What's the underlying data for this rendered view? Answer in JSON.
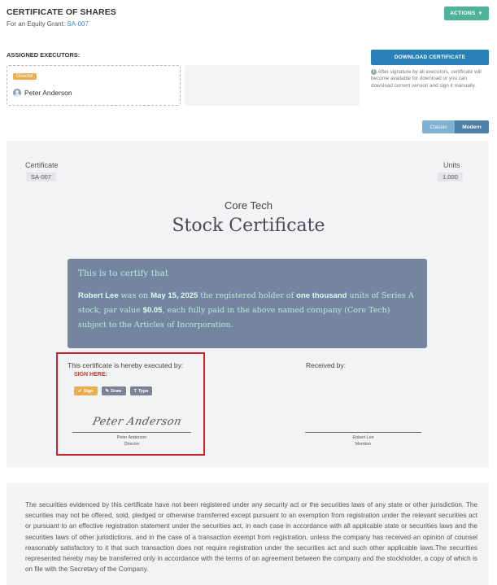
{
  "header": {
    "title": "CERTIFICATE OF SHARES",
    "subtitle_prefix": "For an Equity Grant:",
    "grant_link": "SA-007",
    "actions_label": "ACTIONS"
  },
  "executors": {
    "label": "ASSIGNED EXECUTORS:",
    "items": [
      {
        "role": "Director",
        "name": "Peter Anderson"
      }
    ]
  },
  "download": {
    "button_label": "DOWNLOAD CERTIFICATE",
    "note": "After signature by all executors, certificate will become available for download or you can download current version and sign it manually."
  },
  "view_toggle": {
    "options": [
      "Classic",
      "Modern"
    ],
    "selected": "Modern"
  },
  "certificate": {
    "certificate_label": "Certificate",
    "certificate_value": "SA-007",
    "units_label": "Units",
    "units_value": "1,000",
    "company": "Core Tech",
    "title": "Stock Certificate",
    "certify_heading": "This is to certify that",
    "holder": "Robert Lee",
    "text_1": " was on ",
    "date": "May 15, 2025",
    "text_2": " the registered holder of ",
    "quantity_words": "one thousand",
    "text_3": " units of Series A stock, par value ",
    "par_value": "$0.05",
    "text_4": ", each fully paid in the above named company (Core Tech) subject to the Articles of Incorporation."
  },
  "execution": {
    "executed_by_label": "This certificate is hereby executed by:",
    "sign_here": "SIGN HERE:",
    "tools": {
      "sign": "Sign",
      "draw": "Draw",
      "type": "Type"
    },
    "signature_text": "Peter Anderson",
    "signer_name": "Peter Anderson",
    "signer_role": "Director",
    "received_by_label": "Received by:",
    "receiver_name": "Robert Lee",
    "receiver_role": "Member"
  },
  "legend": "The securities evidenced by this certificate have not been registered under any security act or the securities laws of any state or other jurisdiction. The securities may not be offered, sold, pledged or otherwise transferred except pursuant to an exemption from registration under the relevant securities act or pursuant to an effective registration statement under the securities act, in each case in accordance with all applicable state or securities laws and the securities laws of other jurisdictions, and in the case of a transaction exempt from registration, unless the company has received an opinion of counsel reasonably satisfactory to it that such transaction does not require registration under the securities act and such other applicable laws.The securities represented hereby may be transferred only in accordance with the terms of an agreement between the company and the stockholder, a copy of which is on file with the Secretary of the Company.",
  "colors": {
    "accent_green": "#4fb39b",
    "primary_blue": "#2980b9",
    "certify_box": "#7584a0",
    "highlight_red": "#c8222c",
    "badge_orange": "#e8ad4f"
  }
}
